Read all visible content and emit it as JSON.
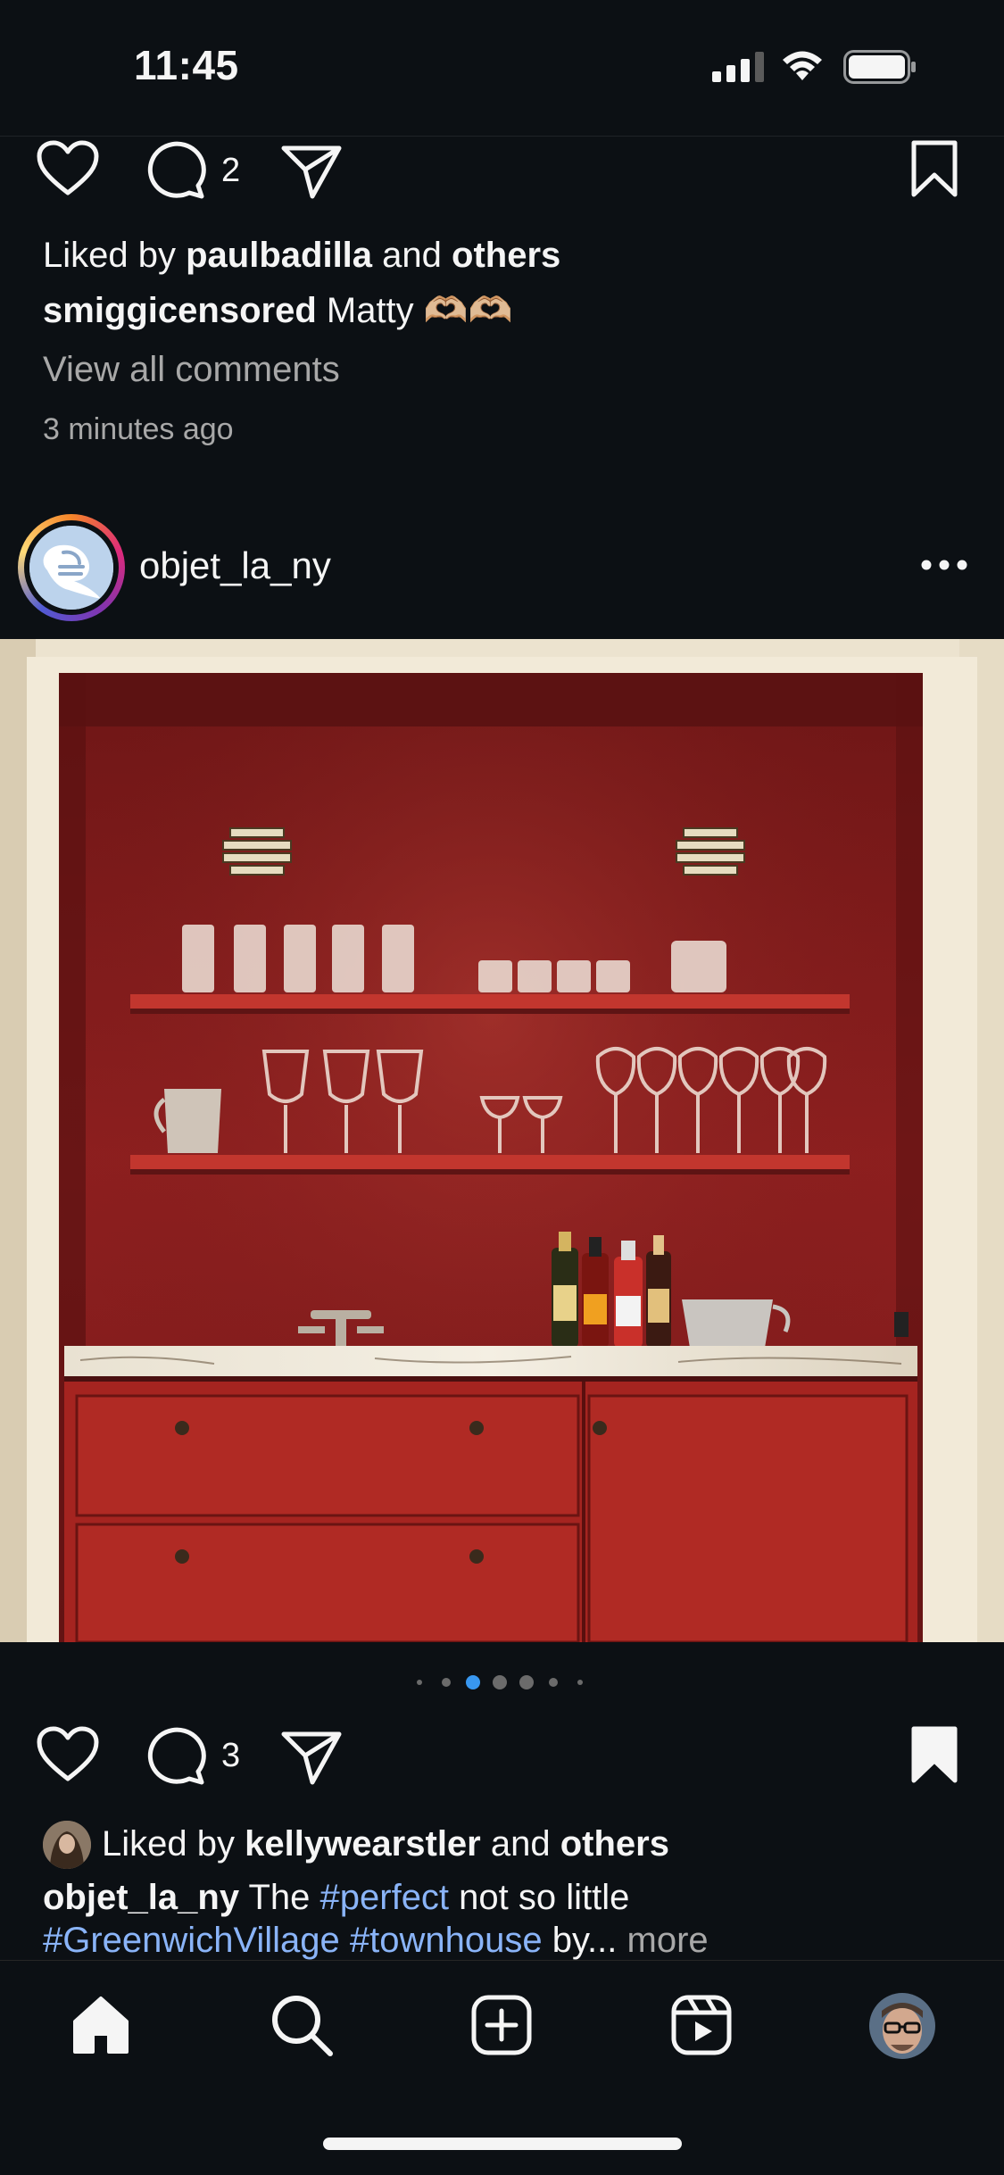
{
  "status_bar": {
    "time": "11:45"
  },
  "previous_post": {
    "comment_count": "2",
    "liked_by": {
      "prefix": "Liked by ",
      "user": "paulbadilla",
      "middle": " and ",
      "suffix": "others"
    },
    "caption": {
      "user": "smiggicensored",
      "text": " Matty 🫶🏼🫶🏼"
    },
    "view_comments": "View all comments",
    "timestamp": "3 minutes ago"
  },
  "post": {
    "username": "objet_la_ny",
    "comment_count": "3",
    "carousel": {
      "count": 7,
      "active_index": 2
    },
    "liked_by": {
      "prefix": "Liked by ",
      "user": "kellywearstler",
      "middle": " and ",
      "suffix": "others"
    },
    "caption": {
      "user": "objet_la_ny",
      "text_1": " The ",
      "tag_1": "#perfect",
      "text_2": " not so little",
      "tag_2": "#GreenwichVillage",
      "tag_3": "#townhouse",
      "text_3": " by...",
      "more": " more"
    }
  },
  "bottom_nav": {
    "items": [
      "home-icon",
      "search-icon",
      "create-icon",
      "reels-icon",
      "profile-avatar"
    ],
    "active": "home-icon"
  },
  "colors": {
    "background": "#0c1014",
    "text": "#f5f5f5",
    "muted": "#a8a8a8",
    "hashtag": "#8ab4f8",
    "carousel_active": "#3897f0",
    "wall_red": "#8e1c1c"
  }
}
